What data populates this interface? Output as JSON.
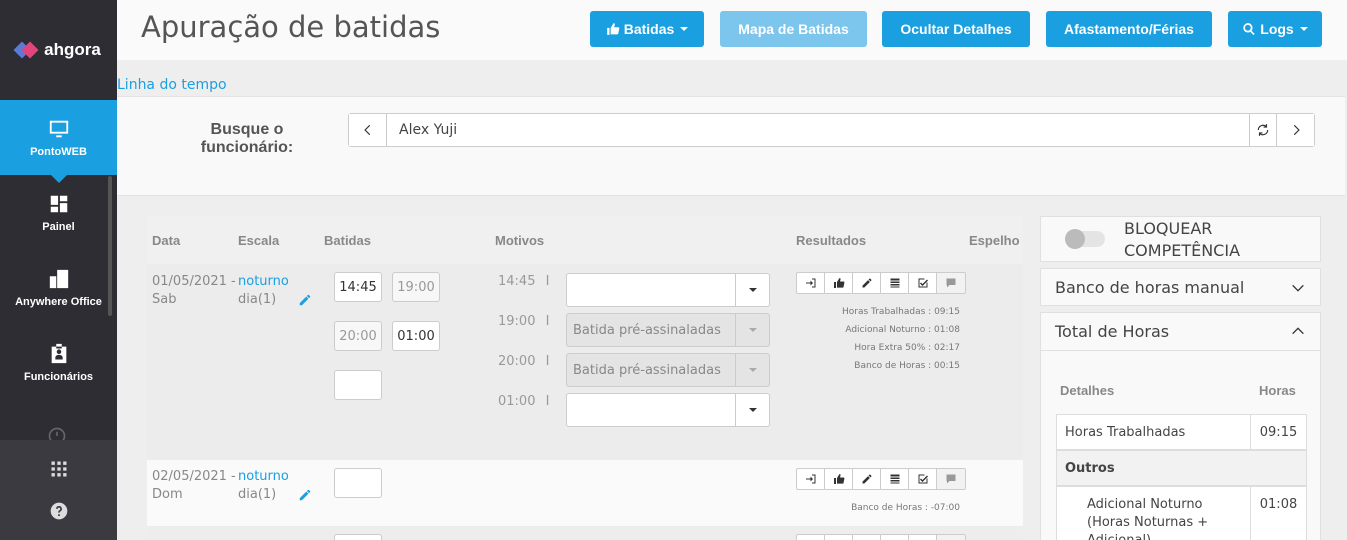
{
  "brand": {
    "name": "ahgora"
  },
  "sidebar": {
    "items": [
      {
        "label": "PontoWEB",
        "icon": "monitor-icon",
        "active": true
      },
      {
        "label": "Painel",
        "icon": "dashboard-icon",
        "active": false
      },
      {
        "label": "Anywhere Office",
        "icon": "building-icon",
        "active": false
      },
      {
        "label": "Funcionários",
        "icon": "badge-icon",
        "active": false
      }
    ]
  },
  "header": {
    "title": "Apuração de batidas",
    "buttons": {
      "batidas": "Batidas",
      "mapa": "Mapa de Batidas",
      "ocultar": "Ocultar Detalhes",
      "afastamento": "Afastamento/Férias",
      "logs": "Logs"
    }
  },
  "timeline_link": "Linha do tempo",
  "search": {
    "label": "Busque o funcionário:",
    "value": "Alex Yuji"
  },
  "table": {
    "headers": {
      "data": "Data",
      "escala": "Escala",
      "batidas": "Batidas",
      "motivos": "Motivos",
      "resultados": "Resultados",
      "espelho": "Espelho"
    },
    "rows": [
      {
        "date": "01/05/2021 -",
        "weekday": "Sab",
        "scale": "noturno",
        "scale_sub": "dia(1)",
        "punches": [
          "14:45",
          "19:00",
          "20:00",
          "01:00",
          ""
        ],
        "motive_times": [
          "14:45",
          "19:00",
          "20:00",
          "01:00"
        ],
        "motive_sep": "I",
        "motives": [
          "",
          "Batida pré-assinaladas",
          "Batida pré-assinaladas",
          ""
        ],
        "results": [
          "Horas Trabalhadas : 09:15",
          "Adicional Noturno : 01:08",
          "Hora Extra 50% : 02:17",
          "Banco de Horas : 00:15"
        ]
      },
      {
        "date": "02/05/2021 -",
        "weekday": "Dom",
        "scale": "noturno",
        "scale_sub": "dia(1)",
        "punches": [
          ""
        ],
        "results": [
          "Banco de Horas : -07:00"
        ]
      }
    ]
  },
  "right_panel": {
    "bloquear": "BLOQUEAR COMPETÊNCIA",
    "banco_manual": "Banco de horas manual",
    "total_horas": "Total de Horas",
    "totals_headers": {
      "detalhes": "Detalhes",
      "horas": "Horas"
    },
    "totals": [
      {
        "label": "Horas Trabalhadas",
        "value": "09:15"
      },
      {
        "label": "Outros",
        "value": ""
      },
      {
        "label": "Adicional Noturno (Horas Noturnas + Adicional)",
        "value": "01:08"
      }
    ]
  }
}
